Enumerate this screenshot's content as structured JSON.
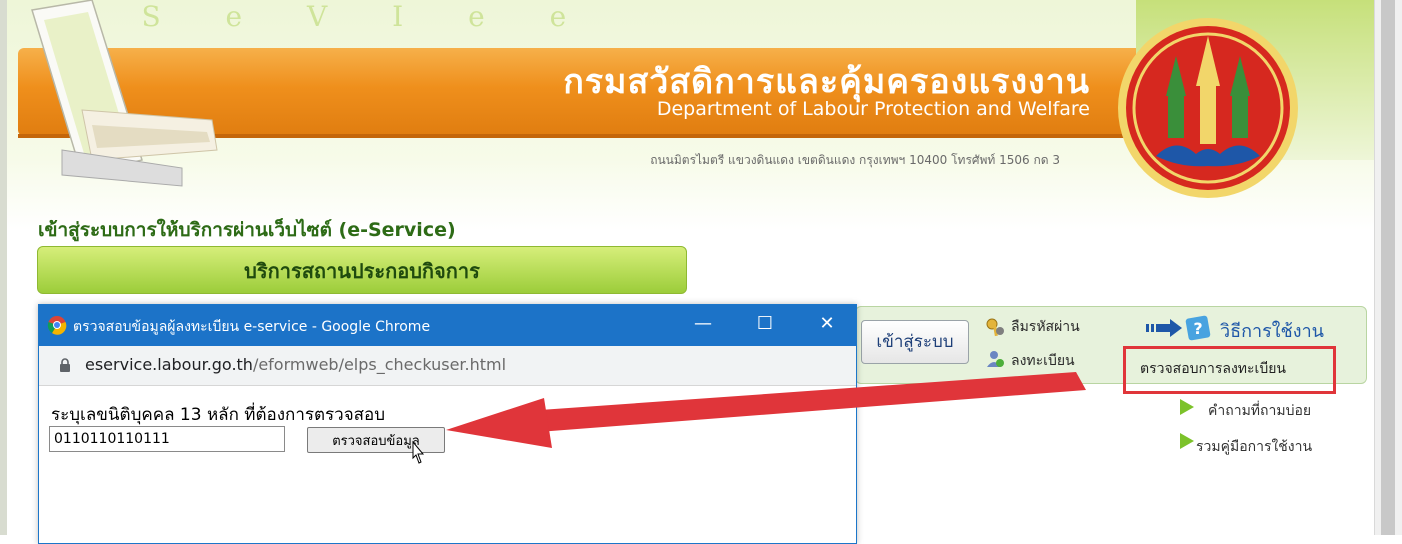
{
  "header": {
    "title_th": "กรมสวัสดิการและคุ้มครองแรงงาน",
    "title_en": "Department of Labour Protection and Welfare",
    "address": "ถนนมิตรไมตรี แขวงดินแดง เขตดินแดง กรุงเทพฯ 10400 โทรศัพท์ 1506 กด 3",
    "decor_text": "e S e V I e e"
  },
  "eservice": {
    "title": "เข้าสู่ระบบการให้บริการผ่านเว็บไซต์ (e-Service)",
    "tab_label": "บริการสถานประกอบกิจการ"
  },
  "login_panel": {
    "login_button": "เข้าสู่ระบบ",
    "forgot_password": "ลืมรหัสผ่าน",
    "register": "ลงทะเบียน",
    "how_to_use": "วิธีการใช้งาน",
    "check_registration": "ตรวจสอบการลงทะเบียน"
  },
  "side_links": {
    "faq": "คำถามที่ถามบ่อย",
    "manual": "รวมคู่มือการใช้งาน"
  },
  "popup": {
    "title": "ตรวจสอบข้อมูลผู้ลงทะเบียน e-service - Google Chrome",
    "url_host": "eservice.labour.go.th",
    "url_path": "/eformweb/elps_checkuser.html",
    "prompt": "ระบุเลขนิติบุคคล 13 หลัก ที่ต้องการตรวจสอบ",
    "input_value": "0110110110111",
    "check_button": "ตรวจสอบข้อมูล",
    "minimize": "—",
    "maximize": "☐",
    "close": "✕"
  },
  "colors": {
    "header_orange": "#ef8f1c",
    "titlebar_blue": "#1c73c8",
    "highlight_red": "#e0353a",
    "service_green": "#9ccd3a"
  },
  "icons": [
    "chrome-icon",
    "lock-icon",
    "key-icon",
    "user-icon",
    "help-icon",
    "arrow-icon",
    "mouse-cursor-icon",
    "seal-emblem"
  ]
}
